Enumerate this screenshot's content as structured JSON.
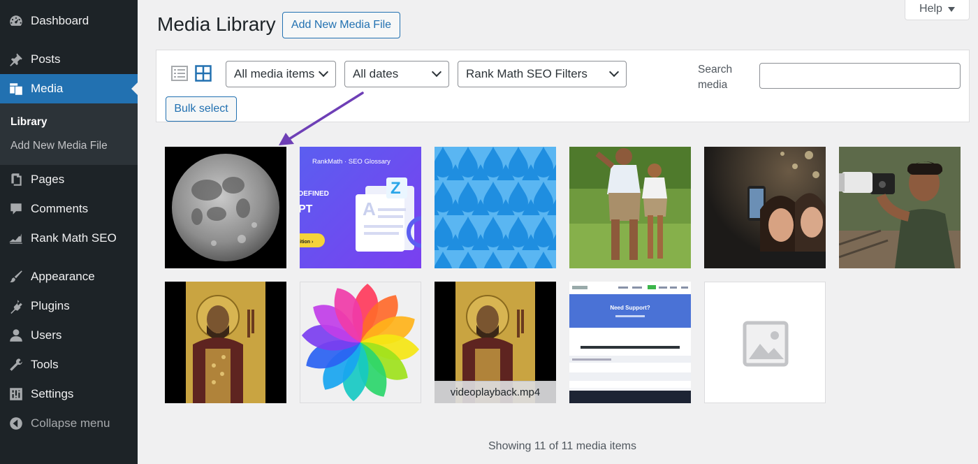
{
  "sidebar": {
    "items": [
      {
        "label": "Dashboard",
        "icon": "dashboard-icon"
      },
      {
        "label": "Posts",
        "icon": "pin-icon"
      },
      {
        "label": "Media",
        "icon": "media-icon"
      },
      {
        "label": "Pages",
        "icon": "pages-icon"
      },
      {
        "label": "Comments",
        "icon": "comment-icon"
      },
      {
        "label": "Rank Math SEO",
        "icon": "rank-math-icon"
      },
      {
        "label": "Appearance",
        "icon": "brush-icon"
      },
      {
        "label": "Plugins",
        "icon": "plugin-icon"
      },
      {
        "label": "Users",
        "icon": "user-icon"
      },
      {
        "label": "Tools",
        "icon": "wrench-icon"
      },
      {
        "label": "Settings",
        "icon": "settings-icon"
      }
    ],
    "active": "Media",
    "submenu": [
      {
        "label": "Library"
      },
      {
        "label": "Add New Media File"
      }
    ],
    "collapse_label": "Collapse menu"
  },
  "header": {
    "help_label": "Help",
    "title": "Media Library",
    "add_new_label": "Add New Media File"
  },
  "toolbar": {
    "type_filter": "All media items",
    "date_filter": "All dates",
    "seo_filter": "Rank Math SEO Filters",
    "search_label": "Search media",
    "search_value": "",
    "bulk_label": "Bulk select"
  },
  "grid": {
    "items": [
      {
        "type": "image",
        "thumb": "moon"
      },
      {
        "type": "image",
        "thumb": "rankmath-seo-glossary",
        "caption": "RankMath · SEO Glossary"
      },
      {
        "type": "image",
        "thumb": "water-drops-pattern"
      },
      {
        "type": "image",
        "thumb": "grandfather-and-boy"
      },
      {
        "type": "image",
        "thumb": "selfie-friends"
      },
      {
        "type": "image",
        "thumb": "photographer"
      },
      {
        "type": "image",
        "thumb": "icon-painting"
      },
      {
        "type": "image",
        "thumb": "color-wheel-flower"
      },
      {
        "type": "video",
        "thumb": "icon-painting",
        "filename": "videoplayback.mp4"
      },
      {
        "type": "image",
        "thumb": "support-form-screenshot",
        "caption": "Need Support?"
      },
      {
        "type": "placeholder",
        "thumb": "image-placeholder-icon"
      }
    ]
  },
  "footer": {
    "count_text": "Showing 11 of 11 media items"
  },
  "colors": {
    "admin_bar": "#1d2327",
    "accent": "#2271b1",
    "annotation_arrow": "#6e3fb6"
  }
}
